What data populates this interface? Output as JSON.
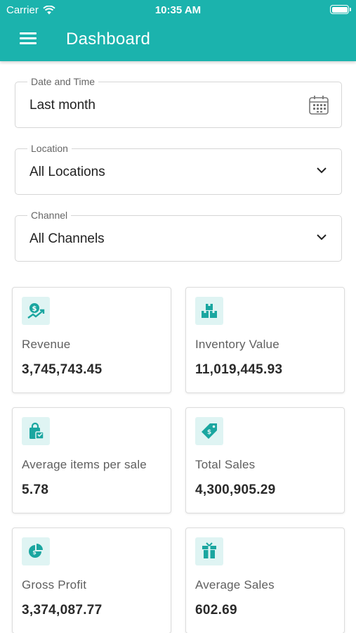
{
  "status_bar": {
    "carrier": "Carrier",
    "time": "10:35 AM"
  },
  "app_bar": {
    "title": "Dashboard",
    "accent": "#1bb3ad"
  },
  "filters": {
    "date": {
      "label": "Date and Time",
      "value": "Last month",
      "icon": "calendar-icon"
    },
    "location": {
      "label": "Location",
      "value": "All Locations",
      "icon": "chevron-down-icon"
    },
    "channel": {
      "label": "Channel",
      "value": "All Channels",
      "icon": "chevron-down-icon"
    }
  },
  "cards": [
    {
      "label": "Revenue",
      "value": "3,745,743.45",
      "icon": "revenue-icon"
    },
    {
      "label": "Inventory Value",
      "value": "11,019,445.93",
      "icon": "inventory-boxes-icon"
    },
    {
      "label": "Average items per sale",
      "value": "5.78",
      "icon": "shopping-bag-icon"
    },
    {
      "label": "Total Sales",
      "value": "4,300,905.29",
      "icon": "price-tag-icon"
    },
    {
      "label": "Gross Profit",
      "value": "3,374,087.77",
      "icon": "pie-chart-icon"
    },
    {
      "label": "Average Sales",
      "value": "602.69",
      "icon": "gift-box-icon"
    }
  ]
}
